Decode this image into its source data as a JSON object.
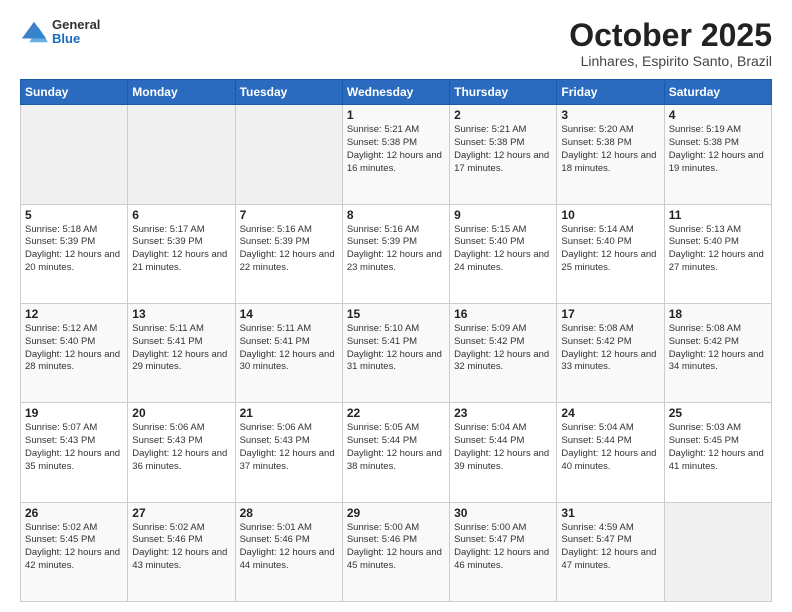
{
  "header": {
    "logo": {
      "general": "General",
      "blue": "Blue"
    },
    "title": "October 2025",
    "location": "Linhares, Espirito Santo, Brazil"
  },
  "weekdays": [
    "Sunday",
    "Monday",
    "Tuesday",
    "Wednesday",
    "Thursday",
    "Friday",
    "Saturday"
  ],
  "weeks": [
    [
      {
        "day": "",
        "info": ""
      },
      {
        "day": "",
        "info": ""
      },
      {
        "day": "",
        "info": ""
      },
      {
        "day": "1",
        "info": "Sunrise: 5:21 AM\nSunset: 5:38 PM\nDaylight: 12 hours\nand 16 minutes."
      },
      {
        "day": "2",
        "info": "Sunrise: 5:21 AM\nSunset: 5:38 PM\nDaylight: 12 hours\nand 17 minutes."
      },
      {
        "day": "3",
        "info": "Sunrise: 5:20 AM\nSunset: 5:38 PM\nDaylight: 12 hours\nand 18 minutes."
      },
      {
        "day": "4",
        "info": "Sunrise: 5:19 AM\nSunset: 5:38 PM\nDaylight: 12 hours\nand 19 minutes."
      }
    ],
    [
      {
        "day": "5",
        "info": "Sunrise: 5:18 AM\nSunset: 5:39 PM\nDaylight: 12 hours\nand 20 minutes."
      },
      {
        "day": "6",
        "info": "Sunrise: 5:17 AM\nSunset: 5:39 PM\nDaylight: 12 hours\nand 21 minutes."
      },
      {
        "day": "7",
        "info": "Sunrise: 5:16 AM\nSunset: 5:39 PM\nDaylight: 12 hours\nand 22 minutes."
      },
      {
        "day": "8",
        "info": "Sunrise: 5:16 AM\nSunset: 5:39 PM\nDaylight: 12 hours\nand 23 minutes."
      },
      {
        "day": "9",
        "info": "Sunrise: 5:15 AM\nSunset: 5:40 PM\nDaylight: 12 hours\nand 24 minutes."
      },
      {
        "day": "10",
        "info": "Sunrise: 5:14 AM\nSunset: 5:40 PM\nDaylight: 12 hours\nand 25 minutes."
      },
      {
        "day": "11",
        "info": "Sunrise: 5:13 AM\nSunset: 5:40 PM\nDaylight: 12 hours\nand 27 minutes."
      }
    ],
    [
      {
        "day": "12",
        "info": "Sunrise: 5:12 AM\nSunset: 5:40 PM\nDaylight: 12 hours\nand 28 minutes."
      },
      {
        "day": "13",
        "info": "Sunrise: 5:11 AM\nSunset: 5:41 PM\nDaylight: 12 hours\nand 29 minutes."
      },
      {
        "day": "14",
        "info": "Sunrise: 5:11 AM\nSunset: 5:41 PM\nDaylight: 12 hours\nand 30 minutes."
      },
      {
        "day": "15",
        "info": "Sunrise: 5:10 AM\nSunset: 5:41 PM\nDaylight: 12 hours\nand 31 minutes."
      },
      {
        "day": "16",
        "info": "Sunrise: 5:09 AM\nSunset: 5:42 PM\nDaylight: 12 hours\nand 32 minutes."
      },
      {
        "day": "17",
        "info": "Sunrise: 5:08 AM\nSunset: 5:42 PM\nDaylight: 12 hours\nand 33 minutes."
      },
      {
        "day": "18",
        "info": "Sunrise: 5:08 AM\nSunset: 5:42 PM\nDaylight: 12 hours\nand 34 minutes."
      }
    ],
    [
      {
        "day": "19",
        "info": "Sunrise: 5:07 AM\nSunset: 5:43 PM\nDaylight: 12 hours\nand 35 minutes."
      },
      {
        "day": "20",
        "info": "Sunrise: 5:06 AM\nSunset: 5:43 PM\nDaylight: 12 hours\nand 36 minutes."
      },
      {
        "day": "21",
        "info": "Sunrise: 5:06 AM\nSunset: 5:43 PM\nDaylight: 12 hours\nand 37 minutes."
      },
      {
        "day": "22",
        "info": "Sunrise: 5:05 AM\nSunset: 5:44 PM\nDaylight: 12 hours\nand 38 minutes."
      },
      {
        "day": "23",
        "info": "Sunrise: 5:04 AM\nSunset: 5:44 PM\nDaylight: 12 hours\nand 39 minutes."
      },
      {
        "day": "24",
        "info": "Sunrise: 5:04 AM\nSunset: 5:44 PM\nDaylight: 12 hours\nand 40 minutes."
      },
      {
        "day": "25",
        "info": "Sunrise: 5:03 AM\nSunset: 5:45 PM\nDaylight: 12 hours\nand 41 minutes."
      }
    ],
    [
      {
        "day": "26",
        "info": "Sunrise: 5:02 AM\nSunset: 5:45 PM\nDaylight: 12 hours\nand 42 minutes."
      },
      {
        "day": "27",
        "info": "Sunrise: 5:02 AM\nSunset: 5:46 PM\nDaylight: 12 hours\nand 43 minutes."
      },
      {
        "day": "28",
        "info": "Sunrise: 5:01 AM\nSunset: 5:46 PM\nDaylight: 12 hours\nand 44 minutes."
      },
      {
        "day": "29",
        "info": "Sunrise: 5:00 AM\nSunset: 5:46 PM\nDaylight: 12 hours\nand 45 minutes."
      },
      {
        "day": "30",
        "info": "Sunrise: 5:00 AM\nSunset: 5:47 PM\nDaylight: 12 hours\nand 46 minutes."
      },
      {
        "day": "31",
        "info": "Sunrise: 4:59 AM\nSunset: 5:47 PM\nDaylight: 12 hours\nand 47 minutes."
      },
      {
        "day": "",
        "info": ""
      }
    ]
  ]
}
